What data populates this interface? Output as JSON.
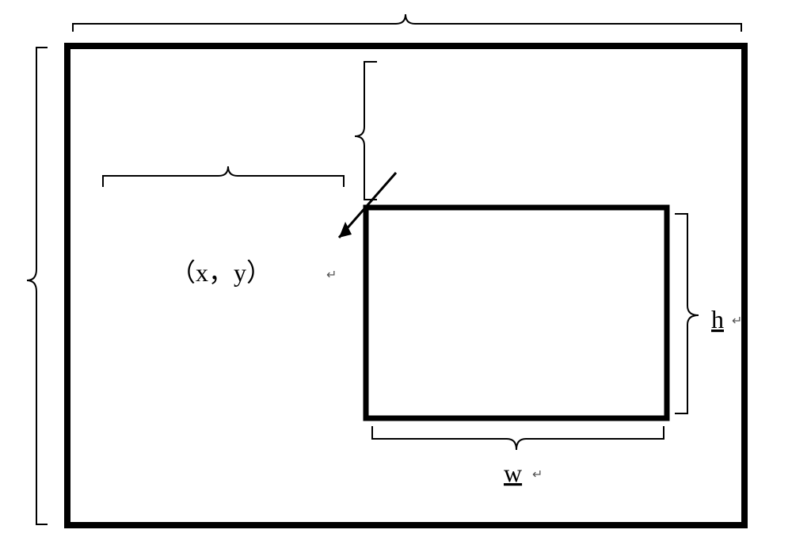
{
  "labels": {
    "xy": "（x，y）",
    "h": "h",
    "w": "w"
  },
  "geometry_note": "Outer rectangle with inner rectangle at offset (x,y); inner rectangle dimensions are w (width) and h (height)."
}
